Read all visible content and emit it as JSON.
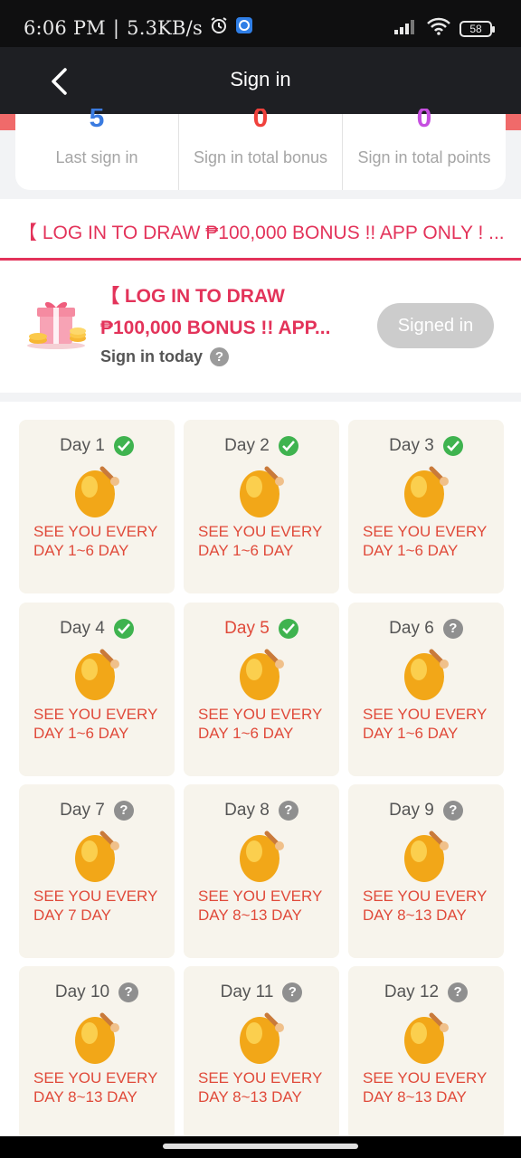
{
  "status_bar": {
    "time": "6:06 PM",
    "network_speed": "5.3KB/s",
    "battery": "58",
    "icons": [
      "alarm-icon",
      "sync-app-icon",
      "signal-icon",
      "wifi-icon",
      "battery-icon"
    ]
  },
  "header": {
    "title": "Sign in"
  },
  "stats": [
    {
      "value": "5",
      "label": "Last sign in",
      "color": "#3a7be0"
    },
    {
      "value": "0",
      "label": "Sign in total bonus",
      "color": "#f0413c"
    },
    {
      "value": "0",
      "label": "Sign in total points",
      "color": "#c64fe0"
    }
  ],
  "marquee": {
    "text": "【 LOG IN TO DRAW ₱100,000 BONUS !! APP ONLY ! ..."
  },
  "signin_panel": {
    "title_line1": "【 LOG IN TO DRAW",
    "title_line2": "₱100,000 BONUS !! APP...",
    "subtitle": "Sign in today",
    "button_label": "Signed in"
  },
  "days": [
    {
      "label": "Day 1",
      "desc": "SEE YOU EVERY DAY 1~6 DAY",
      "done": true,
      "today": false
    },
    {
      "label": "Day 2",
      "desc": "SEE YOU EVERY DAY 1~6 DAY",
      "done": true,
      "today": false
    },
    {
      "label": "Day 3",
      "desc": "SEE YOU EVERY DAY 1~6 DAY",
      "done": true,
      "today": false
    },
    {
      "label": "Day 4",
      "desc": "SEE YOU EVERY DAY 1~6 DAY",
      "done": true,
      "today": false
    },
    {
      "label": "Day 5",
      "desc": "SEE YOU EVERY DAY 1~6 DAY",
      "done": true,
      "today": true
    },
    {
      "label": "Day 6",
      "desc": "SEE YOU EVERY DAY 1~6 DAY",
      "done": false,
      "today": false
    },
    {
      "label": "Day 7",
      "desc": "SEE YOU EVERY DAY 7 DAY",
      "done": false,
      "today": false
    },
    {
      "label": "Day 8",
      "desc": "SEE YOU EVERY DAY 8~13 DAY",
      "done": false,
      "today": false
    },
    {
      "label": "Day 9",
      "desc": "SEE YOU EVERY DAY 8~13 DAY",
      "done": false,
      "today": false
    },
    {
      "label": "Day 10",
      "desc": "SEE YOU EVERY DAY 8~13 DAY",
      "done": false,
      "today": false
    },
    {
      "label": "Day 11",
      "desc": "SEE YOU EVERY DAY 8~13 DAY",
      "done": false,
      "today": false
    },
    {
      "label": "Day 12",
      "desc": "SEE YOU EVERY DAY 8~13 DAY",
      "done": false,
      "today": false
    }
  ],
  "colors": {
    "accent": "#e3335a",
    "day_text": "#e04a3a",
    "check": "#3fb34f",
    "card_bg": "#f7f4ec"
  }
}
